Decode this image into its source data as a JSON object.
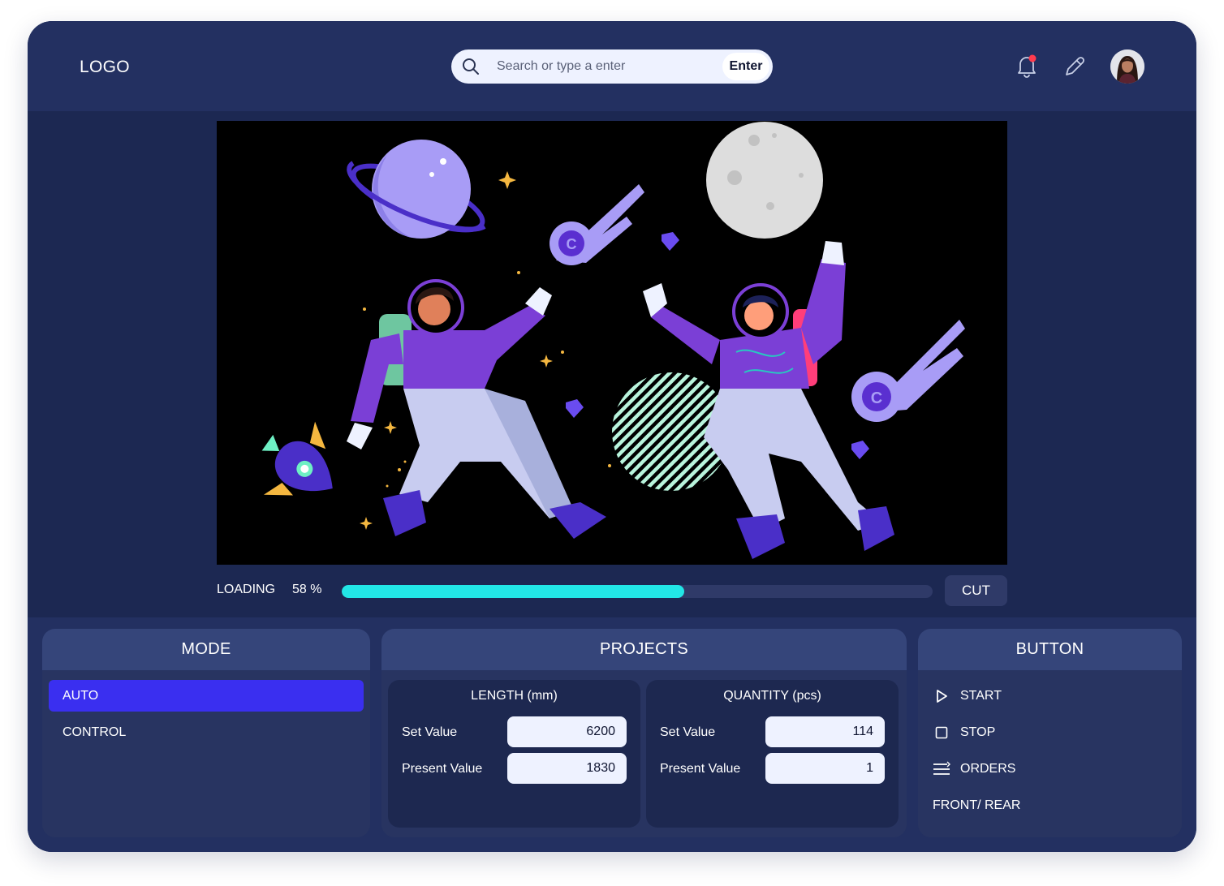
{
  "header": {
    "logo": "LOGO",
    "search": {
      "placeholder": "Search or type a enter",
      "button_label": "Enter"
    },
    "icons": [
      "bell-icon",
      "pencil-icon",
      "avatar"
    ],
    "notification_dot_color": "#ff3b4e"
  },
  "viewer": {
    "image": "astronauts-illustration"
  },
  "loading": {
    "label": "LOADING",
    "percent_text": "58 %",
    "progress": 0.58
  },
  "cut_button": "CUT",
  "mode": {
    "title": "MODE",
    "items": [
      {
        "label": "AUTO",
        "active": true
      },
      {
        "label": "CONTROL",
        "active": false
      }
    ]
  },
  "projects": {
    "title": "PROJECTS",
    "length": {
      "title": "LENGTH (mm)",
      "set_label": "Set Value",
      "set_value": "6200",
      "present_label": "Present Value",
      "present_value": "1830"
    },
    "quantity": {
      "title": "QUANTITY (pcs)",
      "set_label": "Set Value",
      "set_value": "114",
      "present_label": "Present Value",
      "present_value": "1"
    }
  },
  "buttons": {
    "title": "BUTTON",
    "start": "START",
    "stop": "STOP",
    "orders": "ORDERS",
    "front_rear": "FRONT/ REAR"
  },
  "colors": {
    "background": "#1c2852",
    "topbar": "#233061",
    "panel_header": "#35457a",
    "accent_active": "#3a2ff0",
    "progress": "#22e6e6"
  }
}
